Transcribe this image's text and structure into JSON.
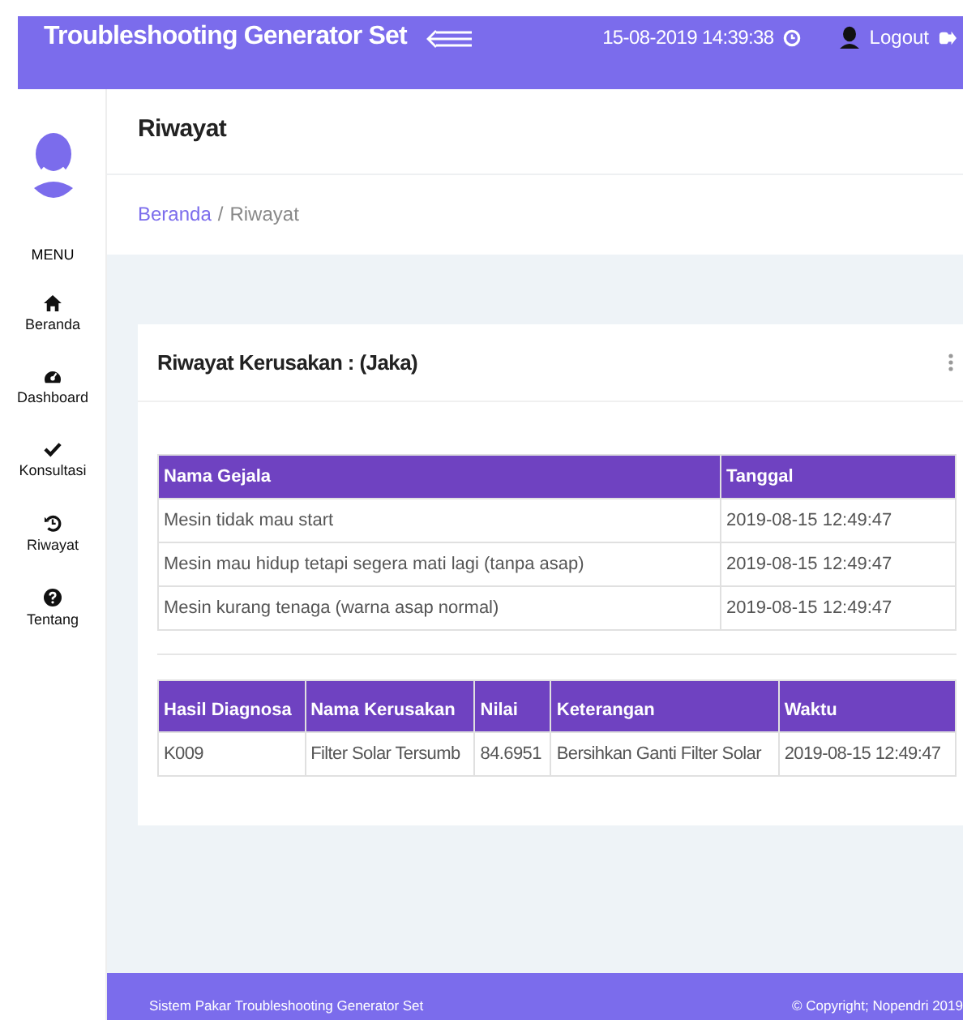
{
  "topbar": {
    "title": "Troubleshooting Generator Set",
    "datetime": "15-08-2019 14:39:38",
    "logout": "Logout"
  },
  "sidebar": {
    "menu_label": "MENU",
    "items": [
      {
        "label": "Beranda"
      },
      {
        "label": "Dashboard"
      },
      {
        "label": "Konsultasi"
      },
      {
        "label": "Riwayat"
      },
      {
        "label": "Tentang"
      }
    ]
  },
  "page": {
    "title": "Riwayat",
    "breadcrumb_separator": "/",
    "breadcrumb": [
      {
        "label": "Beranda",
        "kind": "link"
      },
      {
        "label": "Riwayat",
        "kind": "current"
      }
    ]
  },
  "card": {
    "title_prefix": "Riwayat Kerusakan : ",
    "title_name": "(Jaka)",
    "symptoms": {
      "columns": [
        "Nama Gejala",
        "Tanggal"
      ],
      "rows": [
        [
          "Mesin tidak mau start",
          "2019-08-15 12:49:47"
        ],
        [
          "Mesin mau hidup tetapi segera mati lagi (tanpa asap)",
          "2019-08-15 12:49:47"
        ],
        [
          "Mesin kurang tenaga (warna asap normal)",
          "2019-08-15 12:49:47"
        ]
      ]
    },
    "diagnosis": {
      "columns": [
        "Hasil Diagnosa",
        "Nama Kerusakan",
        "Nilai",
        "Keterangan",
        "Waktu"
      ],
      "rows": [
        [
          "K009",
          "Filter Solar Tersumb",
          "84.6951",
          "Bersihkan Ganti Filter Solar",
          "2019-08-15 12:49:47"
        ]
      ]
    }
  },
  "footer": {
    "left": "Sistem Pakar Troubleshooting Generator Set",
    "right": "© Copyright; Nopendri 2019"
  }
}
